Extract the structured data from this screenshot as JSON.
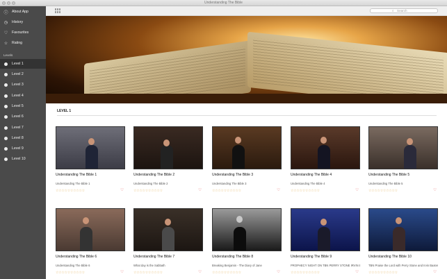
{
  "window": {
    "title": "Understanding The Bible"
  },
  "sidebar": {
    "top_items": [
      {
        "label": "About App",
        "icon": "info-icon"
      },
      {
        "label": "History",
        "icon": "clock-icon"
      },
      {
        "label": "Favourites",
        "icon": "heart-icon"
      },
      {
        "label": "Rating",
        "icon": "star-icon"
      }
    ],
    "levels_header": "Levels",
    "levels": [
      "Level 1",
      "Level 2",
      "Level 3",
      "Level 4",
      "Level 5",
      "Level 6",
      "Level 7",
      "Level 8",
      "Level 9",
      "Level 10"
    ],
    "active_level": "Level 1"
  },
  "toolbar": {
    "search_placeholder": "Search"
  },
  "main": {
    "section_title": "LEVEL 1",
    "cards": [
      {
        "title": "Understanding The Bible 1",
        "subtitle": "Understanding The Bible 1",
        "stars": "☆☆☆☆☆☆☆☆☆☆"
      },
      {
        "title": "Understanding The Bible 2",
        "subtitle": "Understanding The Bible 2",
        "stars": "☆☆☆☆☆☆☆☆☆☆"
      },
      {
        "title": "Understanding The Bible 3",
        "subtitle": "Understanding The Bible 3",
        "stars": "☆☆☆☆☆☆☆☆☆☆"
      },
      {
        "title": "Understanding The Bible 4",
        "subtitle": "Understanding The Bible 4",
        "stars": "☆☆☆☆☆☆☆☆☆☆"
      },
      {
        "title": "Understanding The Bible 5",
        "subtitle": "Understanding The Bible 5",
        "stars": "☆☆☆☆☆☆☆☆☆☆"
      },
      {
        "title": "Understanding The Bible 6",
        "subtitle": "Understanding The Bible 6",
        "stars": "☆☆☆☆☆☆☆☆☆☆"
      },
      {
        "title": "Understanding The Bible 7",
        "subtitle": "What day is the Sabbath",
        "stars": "☆☆☆☆☆☆☆☆☆☆"
      },
      {
        "title": "Understanding The Bible 8",
        "subtitle": "Breaking Benjamin - The Diary of Jane",
        "stars": "☆☆☆☆☆☆☆☆☆☆"
      },
      {
        "title": "Understanding The Bible 9",
        "subtitle": "PROPHECY NIGHT ON TBN PERRY STONE IRVIN BAXTER",
        "stars": "☆☆☆☆☆☆☆☆☆☆"
      },
      {
        "title": "Understanding The Bible 10",
        "subtitle": "TBN Praise the Lord with Perry Stone and Irvin Baxter - 2011",
        "stars": "☆☆☆☆☆☆☆☆☆☆"
      }
    ]
  },
  "colors": {
    "sidebar_bg": "#4a4a4a",
    "active_bg": "#333333",
    "heart": "#e05a5a",
    "star": "#e3b25c"
  }
}
